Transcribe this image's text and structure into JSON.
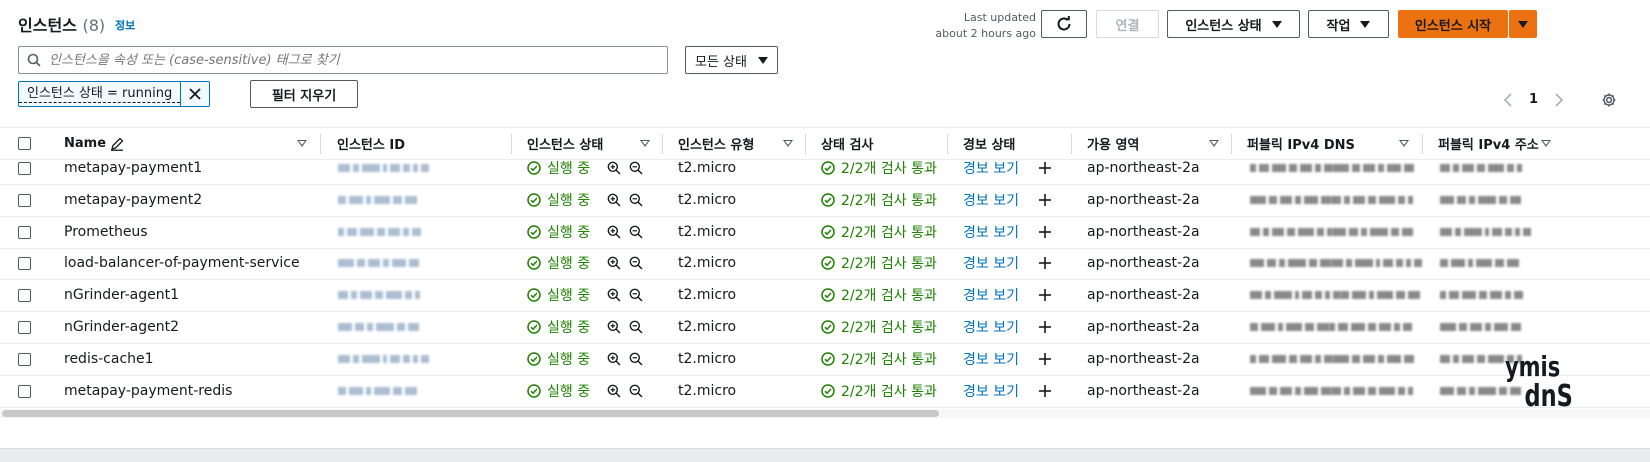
{
  "header": {
    "title": "인스턴스",
    "count": "(8)",
    "info_link": "정보",
    "last_updated_line1": "Last updated",
    "last_updated_line2": "about 2 hours ago",
    "connect_label": "연결",
    "instance_state_label": "인스턴스 상태",
    "actions_label": "작업",
    "launch_label": "인스턴스 시작"
  },
  "search": {
    "placeholder": "인스턴스을 속성 또는 (case-sensitive) 태그로 찾기",
    "state_filter": "모든 상태"
  },
  "filter": {
    "token_label": "인스턴스 상태 = running",
    "clear_label": "필터 지우기"
  },
  "pagination": {
    "current_page": "1"
  },
  "columns": [
    "Name",
    "인스턴스 ID",
    "인스턴스 상태",
    "인스턴스 유형",
    "상태 검사",
    "경보 상태",
    "가용 영역",
    "퍼블릭 IPv4 DNS",
    "퍼블릭 IPv4 주소"
  ],
  "rows": [
    {
      "name": "metapay-payment1",
      "state": "실행 중",
      "type": "t2.micro",
      "check": "2/2개 검사 통과",
      "alarm": "경보 보기",
      "az": "ap-northeast-2a"
    },
    {
      "name": "metapay-payment2",
      "state": "실행 중",
      "type": "t2.micro",
      "check": "2/2개 검사 통과",
      "alarm": "경보 보기",
      "az": "ap-northeast-2a"
    },
    {
      "name": "Prometheus",
      "state": "실행 중",
      "type": "t2.micro",
      "check": "2/2개 검사 통과",
      "alarm": "경보 보기",
      "az": "ap-northeast-2a"
    },
    {
      "name": "load-balancer-of-payment-service",
      "state": "실행 중",
      "type": "t2.micro",
      "check": "2/2개 검사 통과",
      "alarm": "경보 보기",
      "az": "ap-northeast-2a"
    },
    {
      "name": "nGrinder-agent1",
      "state": "실행 중",
      "type": "t2.micro",
      "check": "2/2개 검사 통과",
      "alarm": "경보 보기",
      "az": "ap-northeast-2a"
    },
    {
      "name": "nGrinder-agent2",
      "state": "실행 중",
      "type": "t2.micro",
      "check": "2/2개 검사 통과",
      "alarm": "경보 보기",
      "az": "ap-northeast-2a"
    },
    {
      "name": "redis-cache1",
      "state": "실행 중",
      "type": "t2.micro",
      "check": "2/2개 검사 통과",
      "alarm": "경보 보기",
      "az": "ap-northeast-2a"
    },
    {
      "name": "metapay-payment-redis",
      "state": "실행 중",
      "type": "t2.micro",
      "check": "2/2개 검사 통과",
      "alarm": "경보 보기",
      "az": "ap-northeast-2a"
    }
  ],
  "colors": {
    "accent": "#ec7211",
    "link": "#0073bb",
    "success": "#1d8102"
  },
  "icons": [
    "search-icon",
    "refresh-icon",
    "caret-down-icon",
    "close-icon",
    "chevron-left-icon",
    "chevron-right-icon",
    "gear-icon",
    "edit-icon",
    "zoom-in-icon",
    "zoom-out-icon",
    "check-circle-icon",
    "plus-icon"
  ]
}
